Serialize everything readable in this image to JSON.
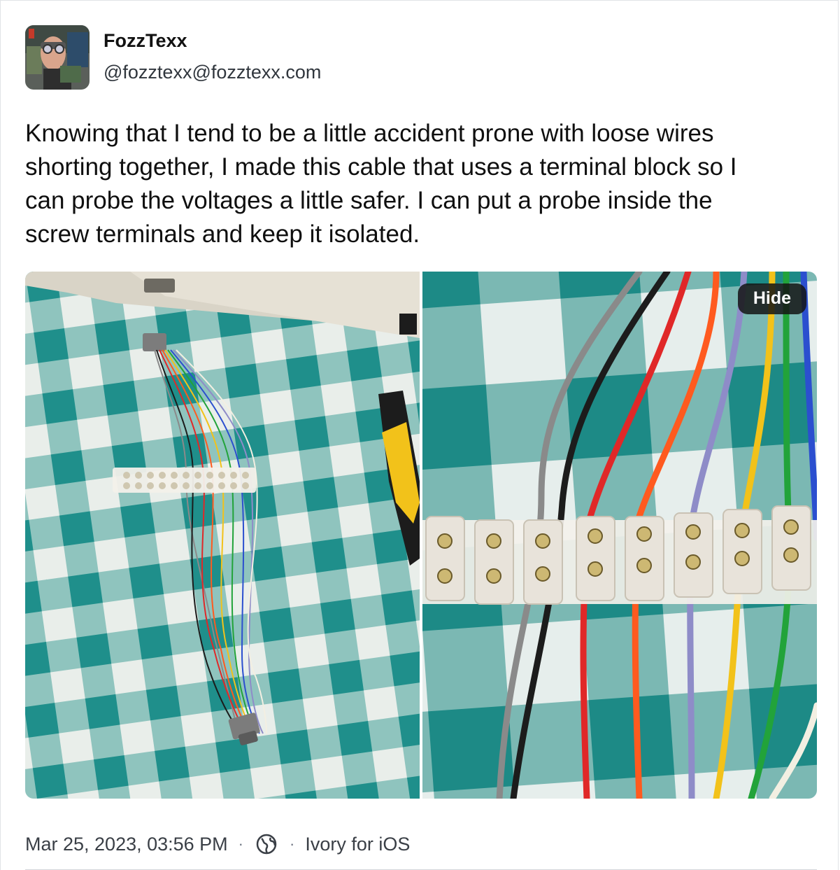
{
  "post": {
    "author_name": "FozzTexx",
    "author_handle": "@fozztexx@fozztexx.com",
    "text": "Knowing that I tend to be a little accident prone with loose wires\nshorting together, I made this cable that uses a terminal block so I\ncan probe the voltages a little safer. I can put a probe inside the\nscrew terminals and keep it isolated.",
    "hide_label": "Hide",
    "timestamp": "Mar 25, 2023, 03:56 PM",
    "separator": "·",
    "visibility_icon": "globe-icon",
    "client": "Ivory for iOS"
  },
  "colors": {
    "gingham_teal": "#1f9a96",
    "gingham_light": "#e9f1ef",
    "gingham_mid": "#8fc2bd",
    "wire_gray": "#8a8a8a",
    "wire_black": "#1c1c1c",
    "wire_red": "#e02828",
    "wire_orange": "#ff5a1f",
    "wire_yellow": "#f2c21a",
    "wire_green": "#22a33a",
    "wire_blue": "#2b4fcf",
    "wire_purple": "#8e8cc8",
    "wire_white": "#f3efe2"
  }
}
